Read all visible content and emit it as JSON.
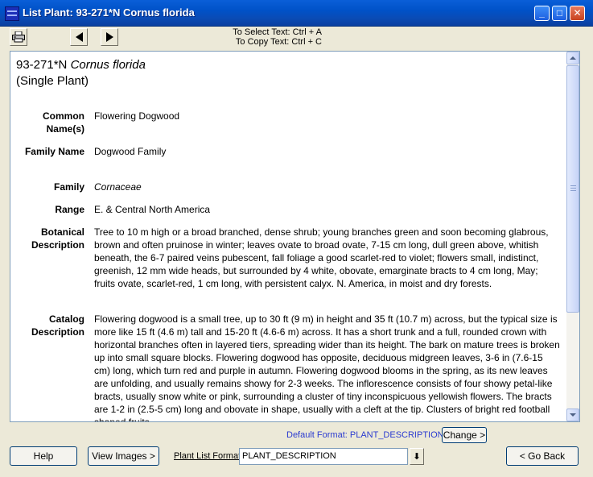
{
  "window": {
    "title": "List Plant: 93-271*N Cornus florida",
    "minimize_glyph": "_",
    "maximize_glyph": "□",
    "close_glyph": "✕"
  },
  "toolbar": {
    "hint_select": "To Select Text: Ctrl + A",
    "hint_copy": "To Copy Text: Ctrl + C",
    "print_icon": "printer-icon",
    "prev_icon": "arrow-left-icon",
    "next_icon": "arrow-right-icon"
  },
  "plant": {
    "accession": "93-271*N",
    "name": "Cornus florida",
    "type": "(Single Plant)",
    "fields": {
      "common_name_label": "Common Name(s)",
      "common_name": "Flowering Dogwood",
      "family_name_label": "Family Name",
      "family_name": "Dogwood Family",
      "family_label": "Family",
      "family": "Cornaceae",
      "range_label": "Range",
      "range": "E. & Central North America",
      "botanical_label": "Botanical Description",
      "botanical": "Tree to 10 m high or a broad branched, dense shrub; young branches green and soon becoming glabrous, brown and often pruinose in winter; leaves ovate to broad ovate, 7-15 cm long, dull green above, whitish beneath, the 6-7 paired veins pubescent, fall foliage a good scarlet-red to violet; flowers small, indistinct, greenish, 12 mm wide heads, but surrounded by 4 white, obovate, emarginate bracts to 4 cm long, May; fruits ovate, scarlet-red, 1 cm long, with persistent calyx. N. America, in moist and dry forests.",
      "catalog_label": "Catalog Description",
      "catalog": "Flowering dogwood is a small tree, up to 30 ft (9 m) in height and 35 ft (10.7 m) across, but the typical size is more like 15 ft (4.6 m) tall and 15-20 ft (4.6-6 m) across. It has a short trunk and a full, rounded crown with horizontal branches often in layered tiers, spreading wider than its height. The bark on mature trees is broken up into small square blocks. Flowering dogwood has opposite, deciduous midgreen leaves, 3-6 in (7.6-15 cm) long, which turn red and purple in autumn. Flowering dogwood blooms in the spring, as its new leaves are unfolding, and usually remains showy for 2-3 weeks. The inflorescence consists of four showy petal-like bracts, usually snow white or pink, surrounding a cluster of tiny inconspicuous yellowish flowers. The bracts are 1-2 in (2.5-5 cm) long and obovate in shape, usually with a cleft at the tip. Clusters of bright red football shaped fruits"
    }
  },
  "footer": {
    "default_format": "Default Format: PLANT_DESCRIPTION",
    "change_button": "Change >",
    "help_button": "Help",
    "view_images_button": "View Images >",
    "plant_list_format_label": "Plant List Format",
    "format_value": "PLANT_DESCRIPTION",
    "dropdown_glyph": "⬇",
    "go_back_button": "< Go Back"
  },
  "colors": {
    "titlebar": "#0052c8",
    "link_blue": "#2b3bd0",
    "content_bg": "#ffffff",
    "window_bg": "#ece9d8"
  }
}
